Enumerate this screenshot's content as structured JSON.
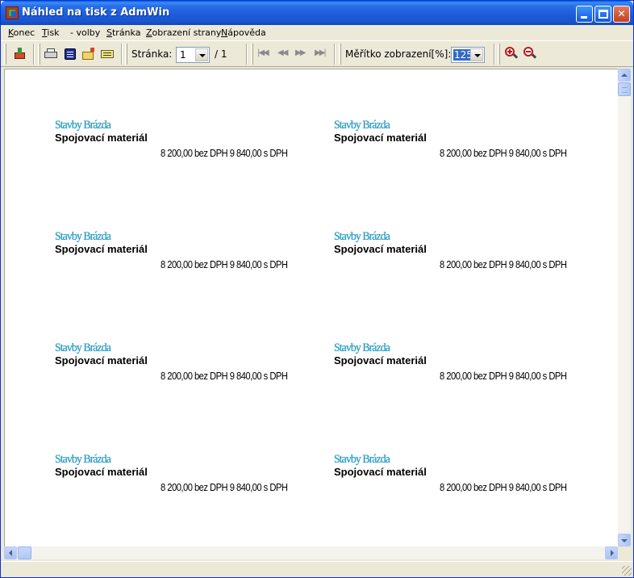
{
  "window": {
    "title": "Náhled na tisk z AdmWin"
  },
  "menu": [
    {
      "label": "Konec",
      "underline": "K",
      "rest": "onec"
    },
    {
      "label": "Tisk",
      "underline": "T",
      "rest": "isk"
    },
    {
      "label": "- volby",
      "underline": "",
      "rest": "- volby"
    },
    {
      "label": "Stránka",
      "underline": "S",
      "rest": "tránka"
    },
    {
      "label": "Zobrazení strany",
      "underline": "Z",
      "rest": "obrazení strany"
    },
    {
      "label": "Nápověda",
      "underline": "N",
      "rest": "ápověda"
    }
  ],
  "toolbar": {
    "page_label": "Stránka:",
    "page_value": "1",
    "page_total": "/ 1",
    "scale_label": "Měřítko zobrazení[%]:",
    "scale_value": "125",
    "nav_first": "|◀◀",
    "nav_prev": "◀◀",
    "nav_next": "▶▶",
    "nav_last": "▶▶|"
  },
  "labels": [
    {
      "brand": "Stavby Brázda",
      "product": "Spojovací materiál",
      "price": "8 200,00 bez DPH 9 840,00 s DPH"
    },
    {
      "brand": "Stavby Brázda",
      "product": "Spojovací materiál",
      "price": "8 200,00 bez DPH 9 840,00 s DPH"
    },
    {
      "brand": "Stavby Brázda",
      "product": "Spojovací materiál",
      "price": "8 200,00 bez DPH 9 840,00 s DPH"
    },
    {
      "brand": "Stavby Brázda",
      "product": "Spojovací materiál",
      "price": "8 200,00 bez DPH 9 840,00 s DPH"
    },
    {
      "brand": "Stavby Brázda",
      "product": "Spojovací materiál",
      "price": "8 200,00 bez DPH 9 840,00 s DPH"
    },
    {
      "brand": "Stavby Brázda",
      "product": "Spojovací materiál",
      "price": "8 200,00 bez DPH 9 840,00 s DPH"
    },
    {
      "brand": "Stavby Brázda",
      "product": "Spojovací materiál",
      "price": "8 200,00 bez DPH 9 840,00 s DPH"
    },
    {
      "brand": "Stavby Brázda",
      "product": "Spojovací materiál",
      "price": "8 200,00 bez DPH 9 840,00 s DPH"
    }
  ],
  "colors": {
    "brand_text": "#2aa0c7",
    "titlebar": "#1c5ad8",
    "close_button": "#c4401e"
  },
  "icons": {
    "exit": "exit-icon",
    "print": "printer-icon",
    "setup": "print-setup-icon",
    "open": "open-folder-icon",
    "fields": "fields-icon",
    "zoom_in": "zoom-in-icon",
    "zoom_out": "zoom-out-icon"
  }
}
